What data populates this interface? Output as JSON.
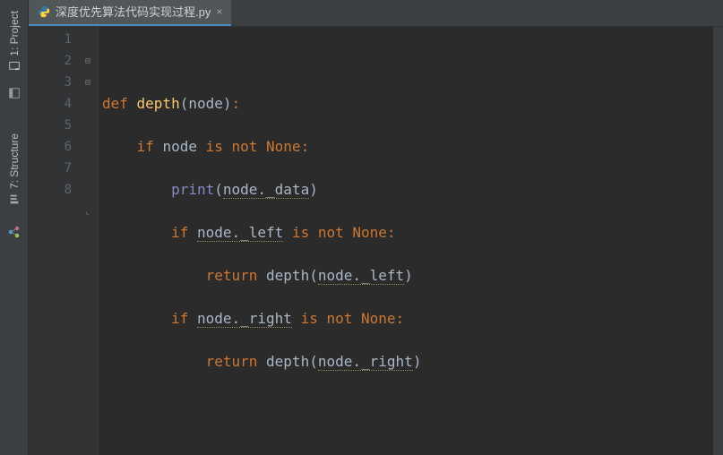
{
  "sidebar": {
    "items": [
      {
        "label": "1: Project"
      },
      {
        "label": "7: Structure"
      }
    ]
  },
  "tab": {
    "filename": "深度优先算法代码实现过程.py",
    "close": "×"
  },
  "lines": {
    "l1": "1",
    "l2": "2",
    "l3": "3",
    "l4": "4",
    "l5": "5",
    "l6": "6",
    "l7": "7",
    "l8": "8"
  },
  "code": {
    "def": "def ",
    "depth": "depth",
    "lp": "(",
    "rp": ")",
    "node": "node",
    "colon": ":",
    "if": "if ",
    "is": " is ",
    "not": "not ",
    "none": "None",
    "print": "print",
    "node_data": "node._data",
    "node_left": "node._left",
    "node_right": "node._right",
    "return": "return ",
    "depthcall": "depth"
  }
}
